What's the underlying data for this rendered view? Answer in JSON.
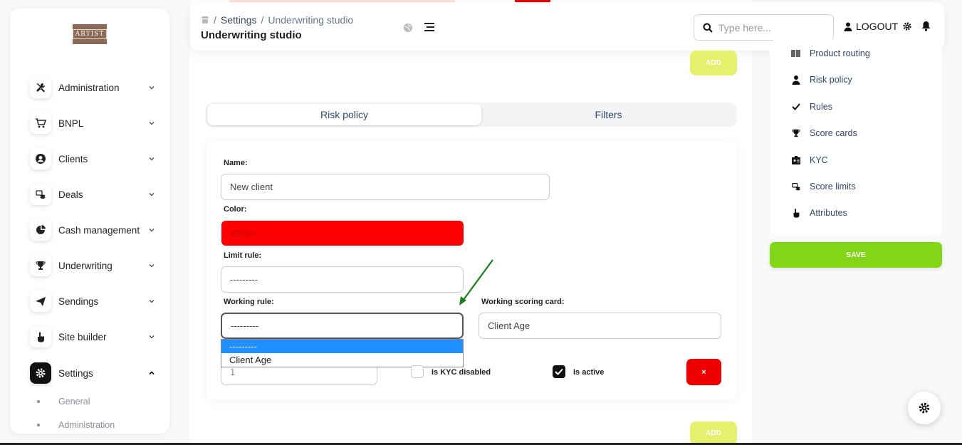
{
  "logo": {
    "text": "ARTIST"
  },
  "sidebar": {
    "items": [
      {
        "label": "Administration",
        "icon": "tools-icon"
      },
      {
        "label": "BNPL",
        "icon": "cart-icon"
      },
      {
        "label": "Clients",
        "icon": "user-circle-icon"
      },
      {
        "label": "Deals",
        "icon": "coins-icon"
      },
      {
        "label": "Cash management",
        "icon": "pie-chart-icon"
      },
      {
        "label": "Underwriting",
        "icon": "trophy-icon"
      },
      {
        "label": "Sendings",
        "icon": "paper-plane-icon"
      },
      {
        "label": "Site builder",
        "icon": "hand-pointer-icon"
      },
      {
        "label": "Settings",
        "icon": "gear-icon"
      }
    ],
    "settings_sub": [
      {
        "label": "General"
      },
      {
        "label": "Administration"
      }
    ]
  },
  "topbar": {
    "breadcrumb": {
      "home_sep": "/",
      "parent": "Settings",
      "sep": "/",
      "current": "Underwriting studio"
    },
    "title": "Underwriting studio",
    "search_placeholder": "Type here...",
    "logout": "LOGOUT"
  },
  "buttons": {
    "add": "ADD",
    "save": "SAVE",
    "delete": "×"
  },
  "tabs": [
    {
      "label": "Risk policy"
    },
    {
      "label": "Filters"
    }
  ],
  "form": {
    "name_label": "Name:",
    "name_value": "New client",
    "color_label": "Color:",
    "color_value": "#ff0000",
    "limit_rule_label": "Limit rule:",
    "limit_rule_value": "---------",
    "working_rule_label": "Working rule:",
    "working_rule_value": "---------",
    "working_scoring_label": "Working scoring card:",
    "working_scoring_value": "Client Age",
    "priority_value": "1",
    "kyc_disabled_label": "Is KYC disabled",
    "is_active_label": "Is active",
    "dropdown_options": [
      "---------",
      "Client Age"
    ]
  },
  "right_panel": {
    "items": [
      {
        "label": "Product routing",
        "icon": "barcode-icon"
      },
      {
        "label": "Risk policy",
        "icon": "user-icon"
      },
      {
        "label": "Rules",
        "icon": "check-icon"
      },
      {
        "label": "Score cards",
        "icon": "trophy-icon"
      },
      {
        "label": "KYC",
        "icon": "id-card-icon"
      },
      {
        "label": "Score limits",
        "icon": "coins-icon"
      },
      {
        "label": "Attributes",
        "icon": "hand-pointer-icon"
      }
    ]
  },
  "colors": {
    "save": "#82d616",
    "add": "#e6f16e",
    "delete": "#ee0000",
    "dropdown_highlight": "#1e90ff",
    "arrow": "#1a7f1a"
  }
}
